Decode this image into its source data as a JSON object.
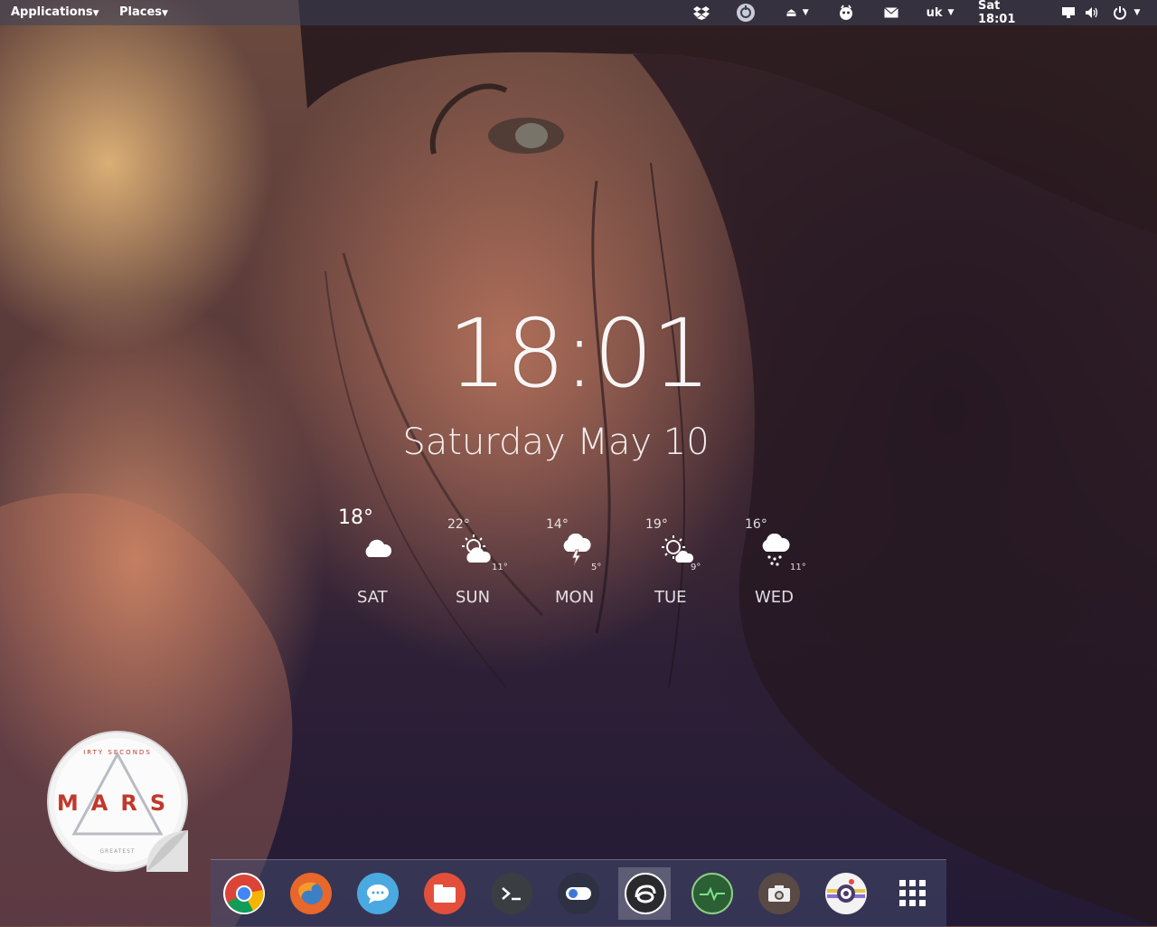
{
  "top_panel": {
    "applications_label": "Applications",
    "places_label": "Places",
    "keyboard_layout": "uk",
    "clock": "Sat 18:01"
  },
  "desktop": {
    "time": "18:01",
    "date": "Saturday May 10"
  },
  "weather": {
    "days": [
      {
        "name": "SAT",
        "high": "18°",
        "low": "",
        "icon": "cloud-icon"
      },
      {
        "name": "SUN",
        "high": "22°",
        "low": "11°",
        "icon": "partly-sunny-icon"
      },
      {
        "name": "MON",
        "high": "14°",
        "low": "5°",
        "icon": "thunderstorm-icon"
      },
      {
        "name": "TUE",
        "high": "19°",
        "low": "9°",
        "icon": "sun-cloud-icon"
      },
      {
        "name": "WED",
        "high": "16°",
        "low": "11°",
        "icon": "rain-icon"
      }
    ]
  },
  "sticker": {
    "top_text": "IRTY SECONDS",
    "main_text": "MARS",
    "bottom_text": "GREATEST",
    "accent": "#c0392b"
  },
  "dock": {
    "items": [
      {
        "icon": "chrome-icon"
      },
      {
        "icon": "firefox-icon"
      },
      {
        "icon": "chat-icon"
      },
      {
        "icon": "files-icon"
      },
      {
        "icon": "terminal-icon"
      },
      {
        "icon": "toggle-settings-icon"
      },
      {
        "icon": "app-active-icon"
      },
      {
        "icon": "system-monitor-icon"
      },
      {
        "icon": "screenshot-icon"
      },
      {
        "icon": "camera-icon"
      },
      {
        "icon": "app-grid-icon"
      }
    ]
  }
}
